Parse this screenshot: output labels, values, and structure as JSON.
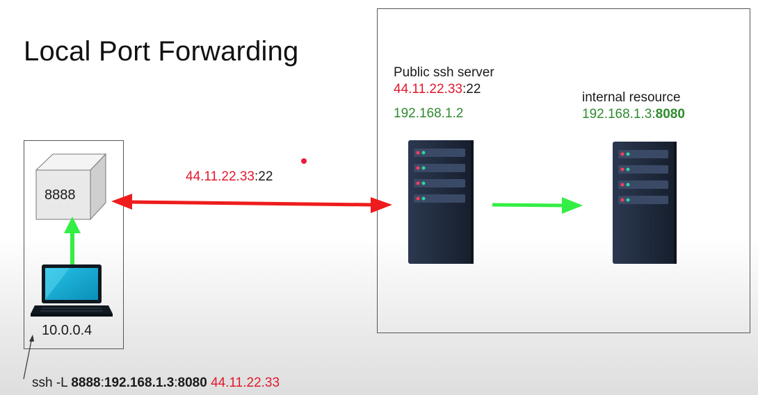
{
  "title": "Local Port Forwarding",
  "local": {
    "port_label": "8888",
    "ip": "10.0.0.4"
  },
  "link": {
    "ip": "44.11.22.33",
    "sep": ":",
    "port": "22"
  },
  "ssh_server": {
    "label": "Public ssh server",
    "public_ip": "44.11.22.33",
    "sep": ":",
    "public_port": "22",
    "private_ip": "192.168.1.2"
  },
  "internal": {
    "label": "internal resource",
    "ip": "192.168.1.3",
    "sep": ":",
    "port": "8080"
  },
  "command": {
    "prefix": "ssh -L ",
    "local_port": "8888",
    "sep1": ":",
    "target_host": "192.168.1.3",
    "sep2": ":",
    "target_port": "8080",
    "space": " ",
    "server": "44.11.22.33"
  },
  "colors": {
    "red": "#e0192d",
    "green": "#2e8b2e",
    "arrow_green": "#33ee44",
    "server_body": "#1f2a3c"
  },
  "icons": [
    "cube-icon",
    "laptop-icon",
    "server-icon"
  ]
}
